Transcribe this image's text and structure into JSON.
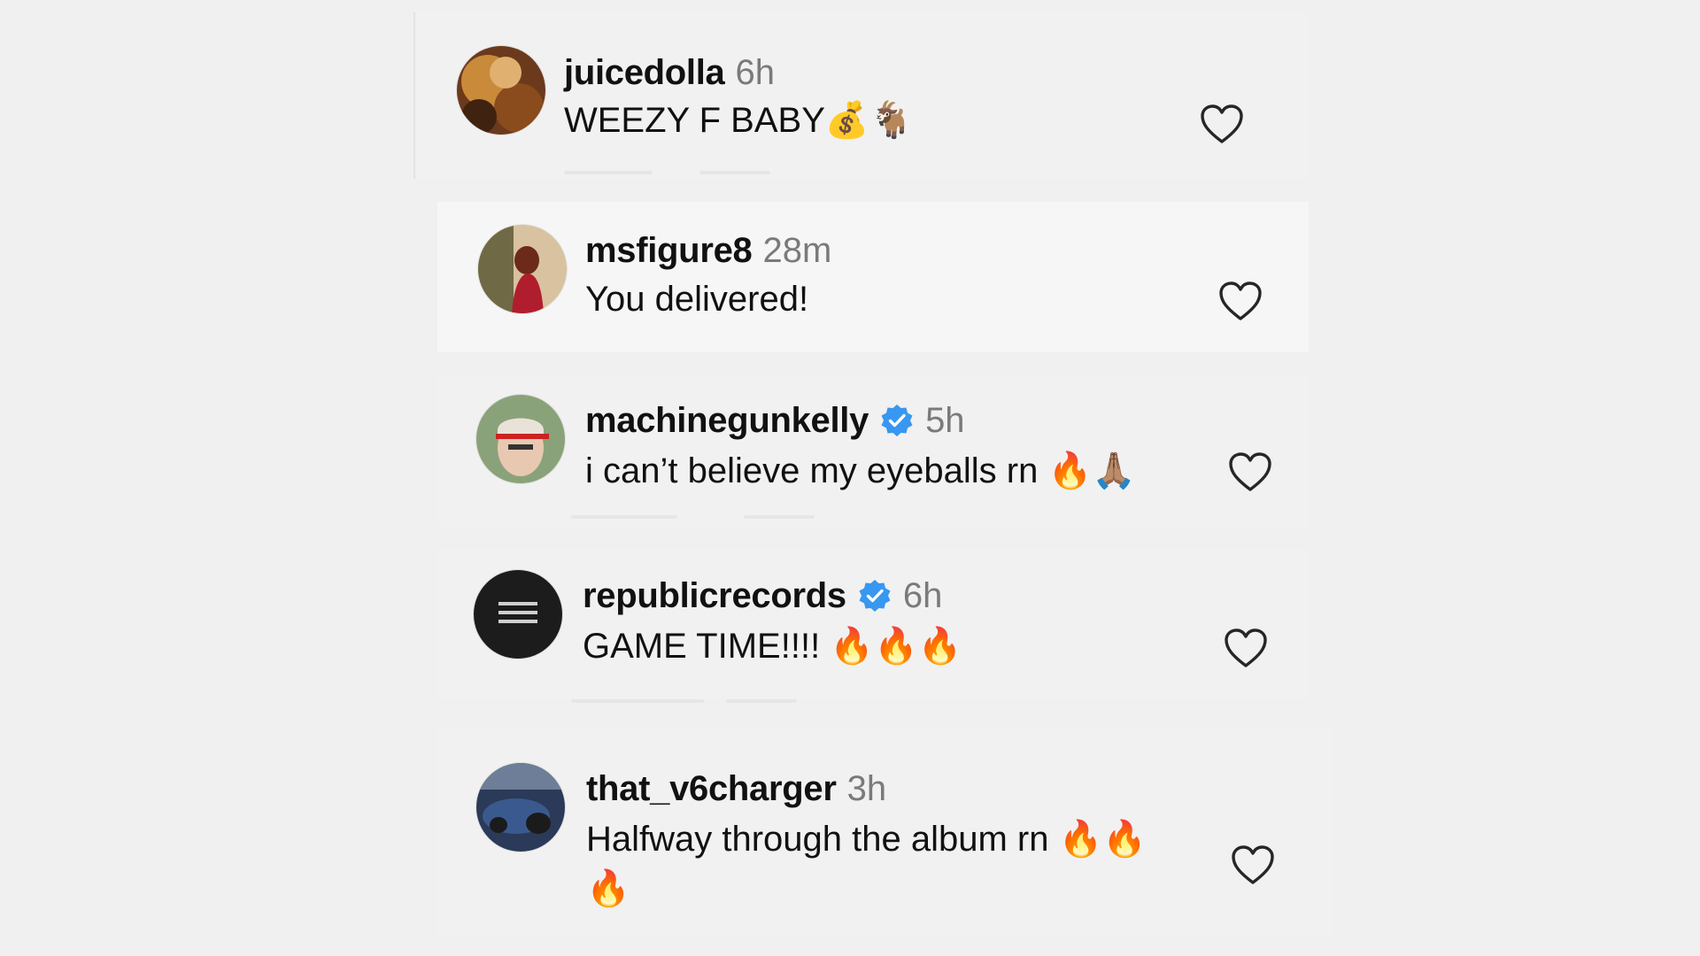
{
  "comments": [
    {
      "username": "juicedolla",
      "time": "6h",
      "text": "WEEZY F BABY💰🐐",
      "verified": false
    },
    {
      "username": "msfigure8",
      "time": "28m",
      "text": "You delivered!",
      "verified": false
    },
    {
      "username": "machinegunkelly",
      "time": "5h",
      "text": "i can’t believe my eyeballs rn 🔥🙏🏽",
      "verified": true
    },
    {
      "username": "republicrecords",
      "time": "6h",
      "text": "GAME TIME!!!! 🔥🔥🔥",
      "verified": true
    },
    {
      "username": "that_v6charger",
      "time": "3h",
      "text": "Halfway through the album rn 🔥🔥",
      "text_line2": "🔥",
      "verified": false
    }
  ],
  "icons": {
    "like": "heart-outline-icon",
    "verified": "verified-badge-icon"
  },
  "colors": {
    "verified_badge": "#3897f0",
    "timestamp": "#7a7a7a",
    "background": "#f0f0f0"
  }
}
